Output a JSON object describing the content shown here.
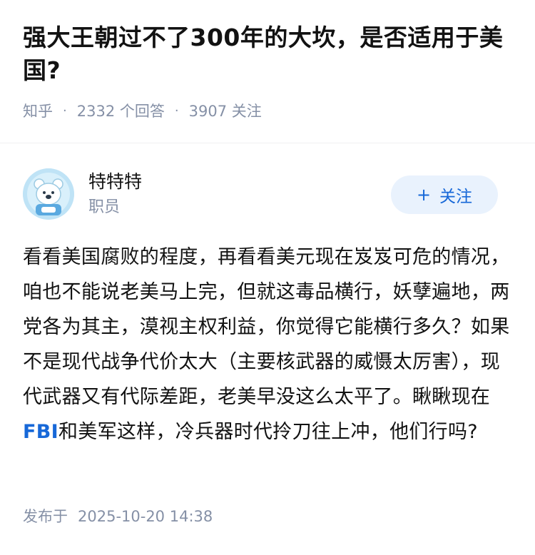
{
  "question": {
    "title": "强大王朝过不了300年的大坎，是否适用于美国?",
    "source": "知乎",
    "answers_count": "2332",
    "answers_label": "个回答",
    "followers_count": "3907",
    "followers_label": "关注",
    "separator": "·"
  },
  "author": {
    "name": "特特特",
    "bio": "职员",
    "follow_plus": "+",
    "follow_label": "关注"
  },
  "answer": {
    "text_before_link": "看看美国腐败的程度，再看看美元现在岌岌可危的情况，咱也不能说老美马上完，但就这毒品横行，妖孽遍地，两党各为其主，漠视主权利益，你觉得它能横行多久？如果不是现代战争代价太大（主要核武器的威慑太厉害），现代武器又有代际差距，老美早没这么太平了。瞅瞅现在",
    "link_text": "FBI",
    "text_after_link": "和美军这样，冷兵器时代拎刀往上冲，他们行吗?"
  },
  "publish": {
    "label": "发布于",
    "datetime": "2025-10-20 14:38"
  },
  "colors": {
    "accent": "#1768d8",
    "muted": "#8590a6",
    "follow_bg": "#e9f2fd"
  }
}
